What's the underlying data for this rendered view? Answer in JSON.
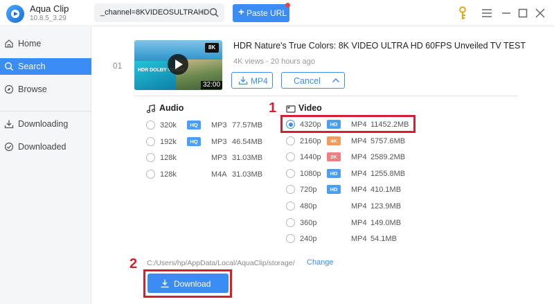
{
  "app": {
    "name": "Aqua Clip",
    "version": "10.8.5_3.29"
  },
  "search": {
    "value": "_channel=8KVIDEOSULTRAHD"
  },
  "toolbar": {
    "paste_label": "Paste URL"
  },
  "sidebar": {
    "items": [
      {
        "label": "Home",
        "icon": "home-icon"
      },
      {
        "label": "Search",
        "icon": "search-icon",
        "active": true
      },
      {
        "label": "Browse",
        "icon": "compass-icon"
      },
      {
        "label": "Downloading",
        "icon": "download-icon"
      },
      {
        "label": "Downloaded",
        "icon": "check-circle-icon"
      }
    ]
  },
  "video": {
    "index": "01",
    "title": "HDR Nature's True Colors: 8K VIDEO ULTRA HD 60FPS Unveiled TV TEST",
    "meta": "4K views - 20 hours ago",
    "thumb_badge": "8K",
    "thumb_hdr": "HDR DOLBY VISION",
    "duration": "32:00",
    "format_button": "MP4",
    "cancel_button": "Cancel"
  },
  "audio": {
    "heading": "Audio",
    "options": [
      {
        "quality": "320k",
        "badge": "HQ",
        "format": "MP3",
        "size": "77.57MB"
      },
      {
        "quality": "192k",
        "badge": "HQ",
        "format": "MP3",
        "size": "46.54MB"
      },
      {
        "quality": "128k",
        "badge": "",
        "format": "MP3",
        "size": "31.03MB"
      },
      {
        "quality": "128k",
        "badge": "",
        "format": "M4A",
        "size": "31.03MB"
      }
    ]
  },
  "videoOptions": {
    "heading": "Video",
    "options": [
      {
        "quality": "4320p",
        "badge": "HD",
        "format": "MP4",
        "size": "11452.2MB",
        "selected": true
      },
      {
        "quality": "2160p",
        "badge": "4K",
        "format": "MP4",
        "size": "5757.6MB"
      },
      {
        "quality": "1440p",
        "badge": "2K",
        "format": "MP4",
        "size": "2589.2MB"
      },
      {
        "quality": "1080p",
        "badge": "HD",
        "format": "MP4",
        "size": "1255.8MB"
      },
      {
        "quality": "720p",
        "badge": "HD",
        "format": "MP4",
        "size": "410.1MB"
      },
      {
        "quality": "480p",
        "badge": "",
        "format": "MP4",
        "size": "123.9MB"
      },
      {
        "quality": "360p",
        "badge": "",
        "format": "MP4",
        "size": "149.0MB"
      },
      {
        "quality": "240p",
        "badge": "",
        "format": "MP4",
        "size": "54.1MB"
      }
    ]
  },
  "badgeColors": {
    "HQ": "#4a9ff5",
    "HD": "#4a9ff5",
    "4K": "#f59a5b",
    "2K": "#f07e7e"
  },
  "save": {
    "path": "C:/Users/hp/AppData/Local/AquaClip/storage/",
    "change_label": "Change"
  },
  "download_label": "Download",
  "annotations": {
    "step1": "1",
    "step2": "2"
  },
  "colors": {
    "accent": "#3b8cf5",
    "highlight": "#d81f2e"
  }
}
